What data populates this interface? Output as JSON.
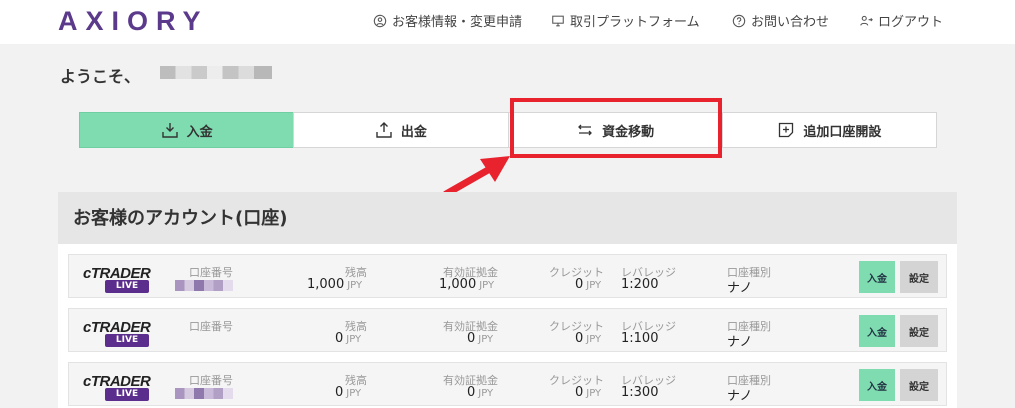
{
  "header": {
    "logo": "AXIORY",
    "nav": [
      {
        "label": "お客様情報・変更申請",
        "icon": "user-circle-icon"
      },
      {
        "label": "取引プラットフォーム",
        "icon": "monitor-icon"
      },
      {
        "label": "お問い合わせ",
        "icon": "question-circle-icon"
      },
      {
        "label": "ログアウト",
        "icon": "logout-icon"
      }
    ]
  },
  "welcome": {
    "greeting": "ようこそ、"
  },
  "tabs": [
    {
      "label": "入金",
      "icon": "deposit-icon",
      "active": true
    },
    {
      "label": "出金",
      "icon": "withdraw-icon",
      "active": false
    },
    {
      "label": "資金移動",
      "icon": "transfer-icon",
      "active": false
    },
    {
      "label": "追加口座開設",
      "icon": "add-account-icon",
      "active": false
    }
  ],
  "accounts_panel": {
    "title": "お客様のアカウント(口座)",
    "labels": {
      "account_number": "口座番号",
      "balance": "残高",
      "equity": "有効証拠金",
      "credit": "クレジット",
      "leverage": "レバレッジ",
      "account_type": "口座種別"
    },
    "currency": "JPY",
    "platform_logo": "cTRADER",
    "platform_badge": "LIVE",
    "deposit_button": "入金",
    "settings_button": "設定",
    "rows": [
      {
        "balance": "1,000",
        "equity": "1,000",
        "credit": "0",
        "leverage": "1:200",
        "type": "ナノ",
        "masked": true
      },
      {
        "balance": "0",
        "equity": "0",
        "credit": "0",
        "leverage": "1:100",
        "type": "ナノ",
        "masked": false
      },
      {
        "balance": "0",
        "equity": "0",
        "credit": "0",
        "leverage": "1:300",
        "type": "ナノ",
        "masked": true
      }
    ]
  },
  "colors": {
    "brand": "#5b3a8c",
    "accent_green": "#7edcb0",
    "highlight_red": "#e8232e"
  }
}
